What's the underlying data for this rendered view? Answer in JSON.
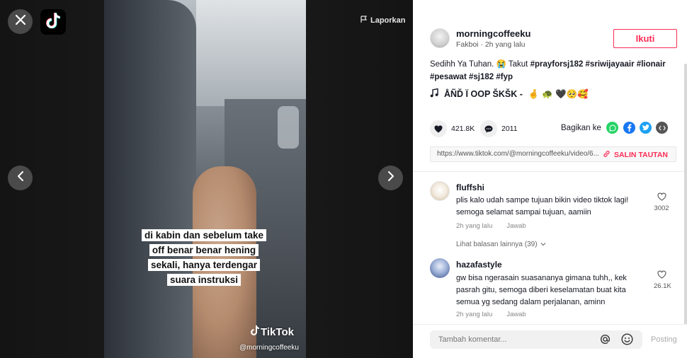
{
  "video": {
    "caption_lines": [
      "di kabin dan sebelum take",
      "off benar benar hening",
      "sekali, hanya terdengar",
      "suara instruksi"
    ],
    "watermark_brand": "TikTok",
    "watermark_handle": "@morningcoffeeku"
  },
  "controls": {
    "report_label": "Laporkan"
  },
  "post": {
    "author": "morningcoffeeku",
    "author_sub": "Fakboi · 2h yang lalu",
    "follow_label": "Ikuti",
    "desc_text": "Sedihh Ya Tuhan. 😭 Takut ",
    "hashtags_line1": "#prayforsj182 #sriwijayaair #lionair",
    "hashtags_line2": "#pesawat #sj182 #fyp",
    "music_title": "ÅÑĎ Ï OOP ŠKŠK -",
    "music_emoji": "🤞 🐢 🖤🥺🥰",
    "likes": "421.8K",
    "comments": "2011",
    "share_label": "Bagikan ke",
    "url": "https://www.tiktok.com/@morningcoffeeku/video/6...",
    "copy_label": "SALIN TAUTAN"
  },
  "comments": [
    {
      "user": "fluffshi",
      "text": "plis kalo udah sampe tujuan bikin video tiktok lagi! semoga selamat sampai tujuan, aamiin",
      "time": "2h yang lalu",
      "reply": "Jawab",
      "likes": "3002"
    },
    {
      "user": "hazafastyle",
      "text": "gw bisa ngerasain suasananya gimana tuhh,, kek pasrah gitu, semoga diberi keselamatan buat kita semua yg sedang dalam perjalanan, aminn",
      "time": "2h yang lalu",
      "reply": "Jawab",
      "likes": "26.1K"
    }
  ],
  "more_replies": "Lihat balasan lainnya (39)",
  "comment_bar": {
    "placeholder": "Tambah komentar...",
    "post_label": "Posting"
  },
  "colors": {
    "brand_red": "#fe2c55",
    "whatsapp": "#25d366",
    "facebook": "#1877f2",
    "twitter": "#1da1f2"
  }
}
